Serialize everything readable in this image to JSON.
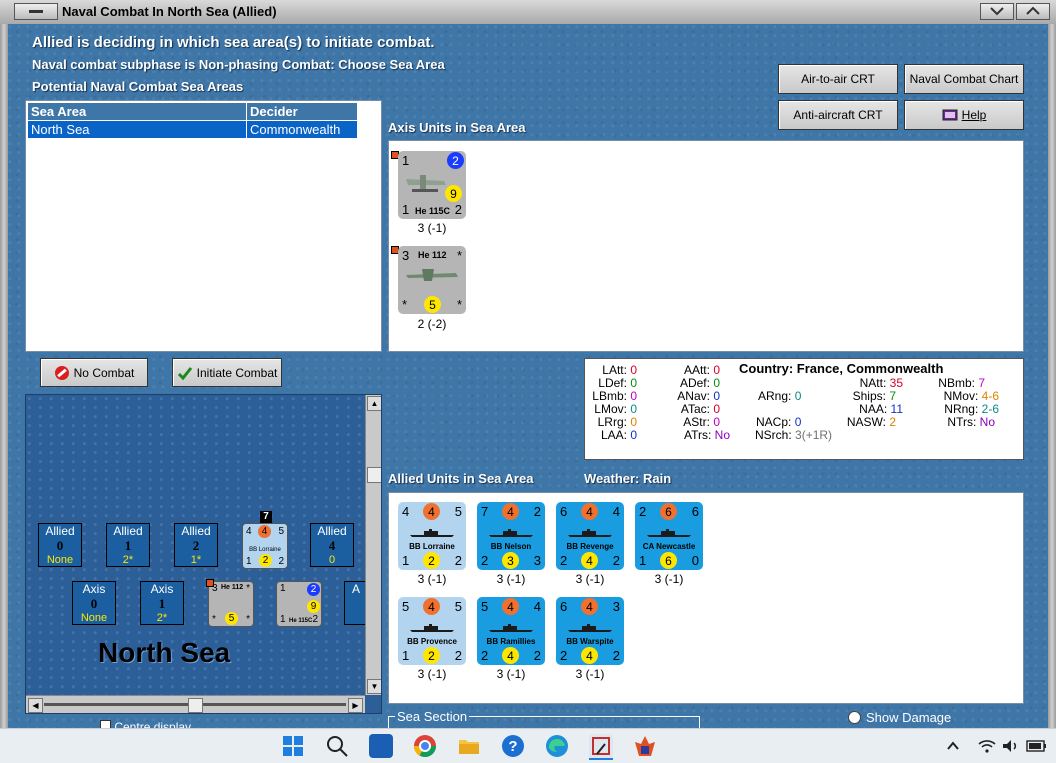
{
  "window": {
    "title": "Naval Combat In North Sea (Allied)"
  },
  "header": {
    "line1": "Allied is deciding in which sea area(s) to initiate combat.",
    "line2": "Naval combat subphase is Non-phasing Combat: Choose Sea Area",
    "line3": "Potential Naval Combat Sea Areas"
  },
  "buttons": {
    "air_crt": "Air-to-air CRT",
    "naval_chart": "Naval Combat Chart",
    "aa_crt": "Anti-aircraft CRT",
    "help": "Help",
    "no_combat": "No Combat",
    "initiate": "Initiate Combat"
  },
  "sea_table": {
    "headers": [
      "Sea Area",
      "Decider"
    ],
    "rows": [
      [
        "North Sea",
        "Commonwealth"
      ]
    ]
  },
  "axis_section": {
    "title": "Axis Units in Sea Area"
  },
  "axis_units": [
    {
      "name": "He 115C",
      "tl": "1",
      "tr": "2",
      "mid": "9",
      "bl": "1",
      "br": "2",
      "caption": "3 (-1)"
    },
    {
      "name": "He 112",
      "tl": "3",
      "tr": "*",
      "mid": "5",
      "bl": "*",
      "br": "*",
      "caption": "2 (-2)"
    }
  ],
  "stats": {
    "country": "Country: France, Commonwealth",
    "col1": [
      [
        "LAtt:",
        "0"
      ],
      [
        "LDef:",
        "0"
      ],
      [
        "LBmb:",
        "0"
      ],
      [
        "LMov:",
        "0"
      ],
      [
        "LRrg:",
        "0"
      ],
      [
        "LAA:",
        "0"
      ]
    ],
    "col2": [
      [
        "AAtt:",
        "0"
      ],
      [
        "ADef:",
        "0"
      ],
      [
        "ANav:",
        "0"
      ],
      [
        "ATac:",
        "0"
      ],
      [
        "AStr:",
        "0"
      ],
      [
        "ATrs:",
        "No"
      ]
    ],
    "arng": [
      "ARng:",
      "0"
    ],
    "nacp": [
      "NACp:",
      "0"
    ],
    "nsrch": [
      "NSrch:",
      "3(+1R)"
    ],
    "col4": [
      [
        "NAtt:",
        "35"
      ],
      [
        "Ships:",
        "7"
      ],
      [
        "NAA:",
        "11"
      ],
      [
        "NASW:",
        "2"
      ]
    ],
    "col5": [
      [
        "NBmb:",
        "7"
      ],
      [
        "NMov:",
        "4-6"
      ],
      [
        "NRng:",
        "2-6"
      ],
      [
        "NTrs:",
        "No"
      ]
    ],
    "colors": {
      "red": "#d8002a",
      "green": "#0a8a0a",
      "blue": "#1530c8",
      "magenta": "#c000c0",
      "orange": "#e08000",
      "teal": "#0a8a8a",
      "purple": "#8a00c0",
      "gray": "#707070"
    }
  },
  "allied_section": {
    "title": "Allied Units in Sea Area",
    "weather": "Weather:  Rain"
  },
  "allied_units": [
    {
      "name": "BB Lorraine",
      "tl": "4",
      "tm": "4",
      "tr": "5",
      "bl": "1",
      "bm": "2",
      "br": "2",
      "caption": "3 (-1)",
      "shade": "light"
    },
    {
      "name": "BB Nelson",
      "tl": "7",
      "tm": "4",
      "tr": "2",
      "bl": "2",
      "bm": "3",
      "br": "3",
      "caption": "3 (-1)",
      "shade": "dark"
    },
    {
      "name": "BB Revenge",
      "tl": "6",
      "tm": "4",
      "tr": "4",
      "bl": "2",
      "bm": "4",
      "br": "2",
      "caption": "3 (-1)",
      "shade": "dark"
    },
    {
      "name": "CA Newcastle",
      "tl": "2",
      "tm": "6",
      "tr": "6",
      "bl": "1",
      "bm": "6",
      "br": "0",
      "caption": "3 (-1)",
      "shade": "dark"
    },
    {
      "name": "BB Provence",
      "tl": "5",
      "tm": "4",
      "tr": "5",
      "bl": "1",
      "bm": "2",
      "br": "2",
      "caption": "3 (-1)",
      "shade": "light"
    },
    {
      "name": "BB Ramillies",
      "tl": "5",
      "tm": "4",
      "tr": "4",
      "bl": "2",
      "bm": "4",
      "br": "2",
      "caption": "3 (-1)",
      "shade": "dark"
    },
    {
      "name": "BB Warspite",
      "tl": "6",
      "tm": "4",
      "tr": "3",
      "bl": "2",
      "bm": "4",
      "br": "2",
      "caption": "3 (-1)",
      "shade": "dark"
    }
  ],
  "map": {
    "sea_name": "North Sea",
    "allied_boxes": [
      {
        "label": "Allied",
        "num": "0",
        "bot": "None"
      },
      {
        "label": "Allied",
        "num": "1",
        "bot": "2*"
      },
      {
        "label": "Allied",
        "num": "2",
        "bot": "1*"
      },
      {
        "label": "Allied",
        "num": "4",
        "bot": "0"
      }
    ],
    "axis_boxes": [
      {
        "label": "Axis",
        "num": "0",
        "bot": "None"
      },
      {
        "label": "Axis",
        "num": "1",
        "bot": "2*"
      },
      {
        "label": "A",
        "num": "",
        "bot": ""
      }
    ],
    "stack_count": "7",
    "mini_lorraine": {
      "name": "BB Lorraine",
      "tl": "4",
      "tm": "4",
      "tr": "5",
      "bl": "1",
      "bm": "2",
      "br": "2"
    },
    "mini_he112": {
      "name": "He 112",
      "tl": "3",
      "tr": "*",
      "mid": "5",
      "bl": "*",
      "br": "*"
    },
    "mini_he115": {
      "name": "He 115C",
      "tl": "1",
      "tr": "2",
      "mid": "9",
      "bl": "1",
      "br": "2"
    },
    "cut_label": "Centre display"
  },
  "bottom": {
    "sea_section": "Sea Section",
    "show_damage": "Show Damage"
  },
  "taskbar": {
    "icons": [
      "windows-start-icon",
      "search-icon",
      "myhp-icon",
      "chrome-icon",
      "file-explorer-icon",
      "help-icon",
      "edge-icon",
      "snipping-tool-icon",
      "game-icon"
    ]
  }
}
